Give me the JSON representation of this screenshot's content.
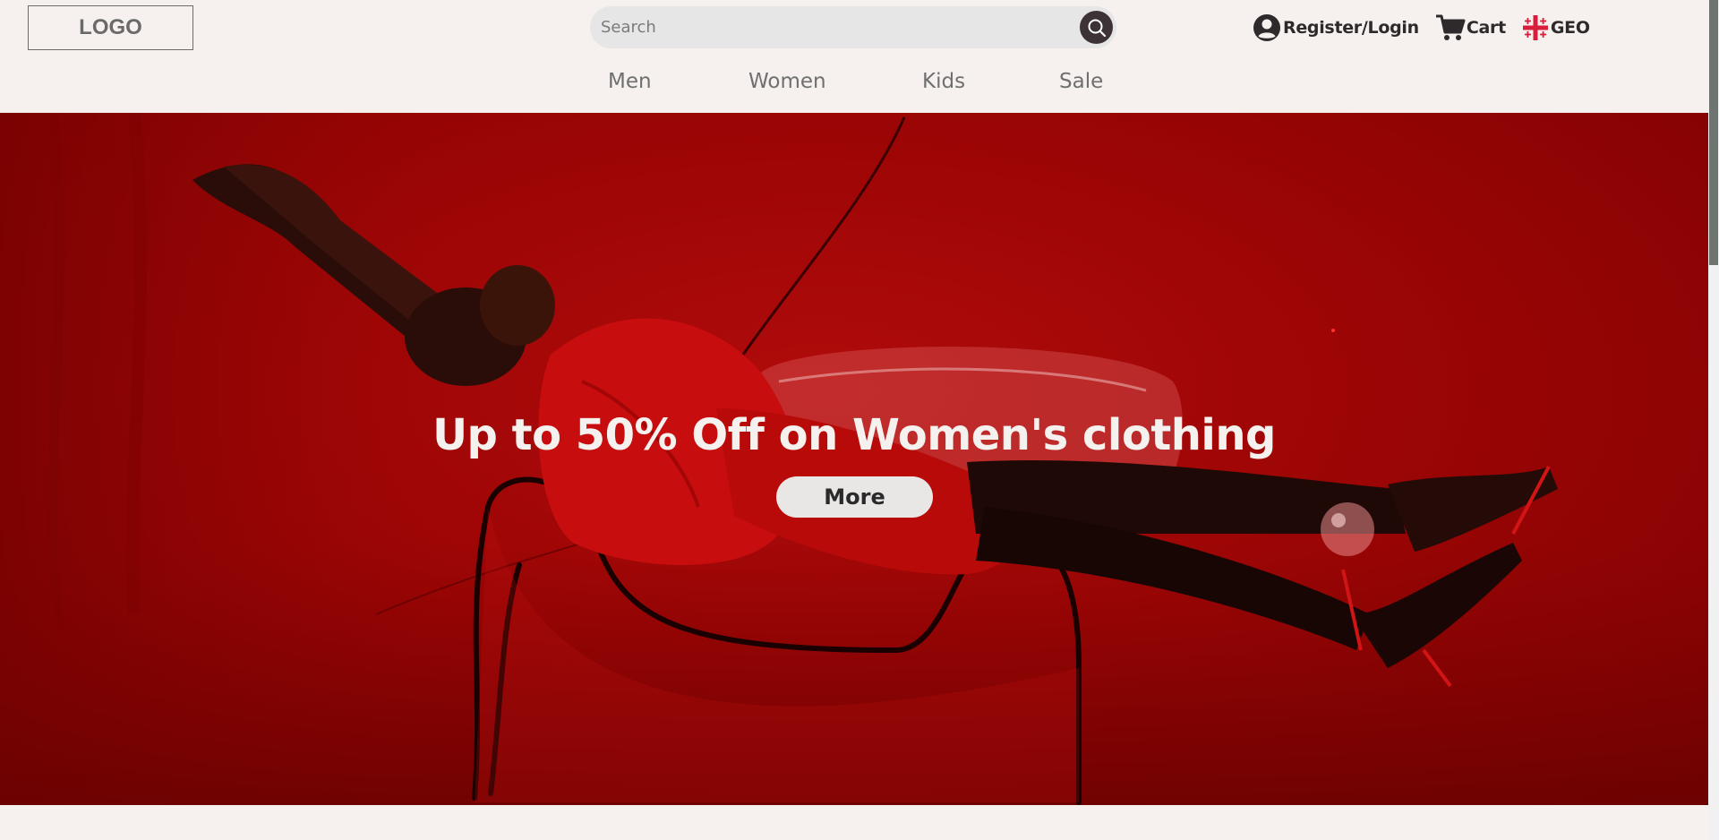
{
  "header": {
    "logo_text": "LOGO",
    "search": {
      "placeholder": "Search",
      "value": ""
    },
    "actions": {
      "account_label": "Register/Login",
      "cart_label": "Cart",
      "language_label": "GEO"
    },
    "colors": {
      "background": "#f6f1ee",
      "flag_red": "#d81e3a",
      "dark": "#2e2a2c"
    }
  },
  "nav": {
    "items": [
      {
        "label": "Men"
      },
      {
        "label": "Women"
      },
      {
        "label": "Kids"
      },
      {
        "label": "Sale"
      }
    ]
  },
  "hero": {
    "title": "Up to 50% Off on Women's clothing",
    "button_label": "More",
    "background_color": "#9c0505"
  },
  "icons": [
    "search-icon",
    "user-icon",
    "cart-icon",
    "georgia-flag-icon"
  ]
}
